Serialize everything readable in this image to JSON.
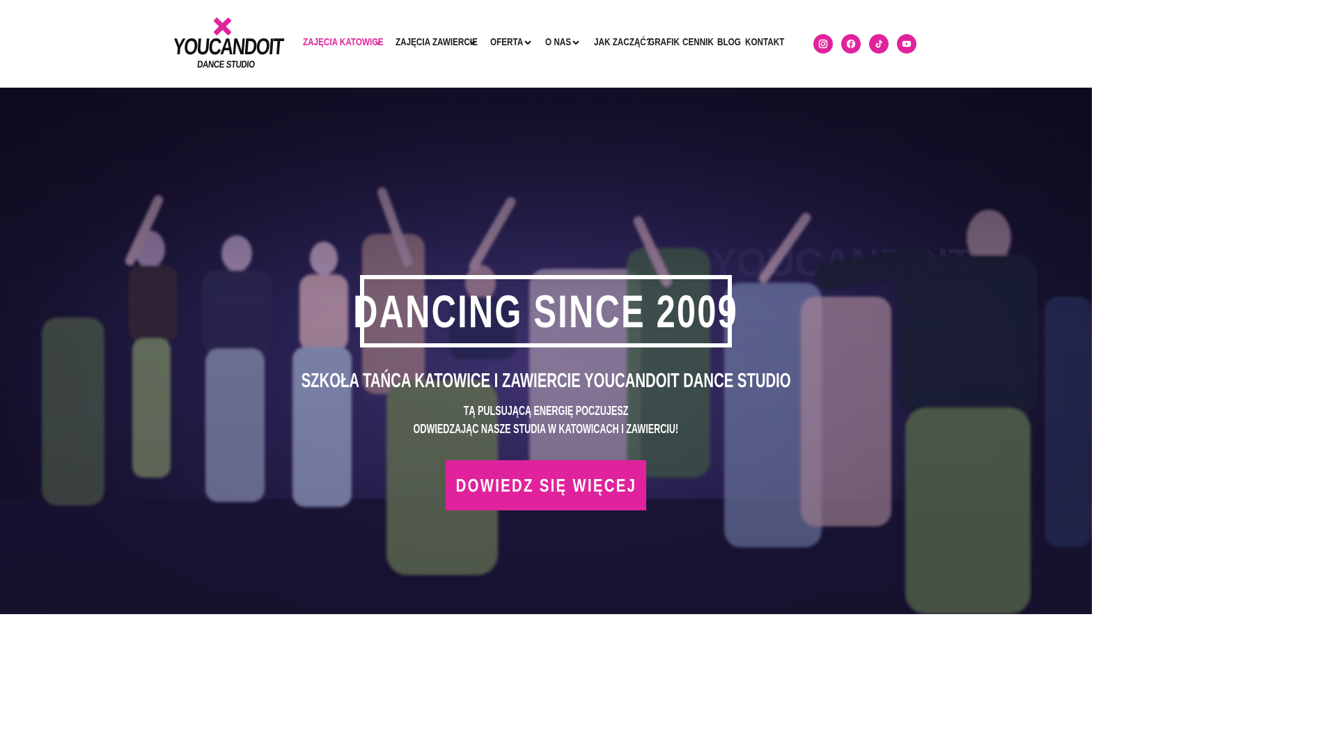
{
  "brand": {
    "logo_word": "YOUCANDOIT",
    "logo_sub": "DANCE STUDIO",
    "accent_color": "#e0239c"
  },
  "nav": {
    "items": [
      {
        "label": "ZAJĘCIA KATOWICE",
        "dropdown": true,
        "active": true
      },
      {
        "label": "ZAJĘCIA ZAWIERCIE",
        "dropdown": true,
        "active": false
      },
      {
        "label": "OFERTA",
        "dropdown": true,
        "active": false
      },
      {
        "label": "O NAS",
        "dropdown": true,
        "active": false
      },
      {
        "label": "JAK ZACZĄĆ?",
        "dropdown": false,
        "active": false
      },
      {
        "label": "GRAFIK",
        "dropdown": false,
        "active": false
      },
      {
        "label": "CENNIK",
        "dropdown": false,
        "active": false
      },
      {
        "label": "BLOG",
        "dropdown": false,
        "active": false
      },
      {
        "label": "KONTAKT",
        "dropdown": false,
        "active": false
      }
    ]
  },
  "socials": [
    {
      "icon": "instagram-icon"
    },
    {
      "icon": "facebook-icon"
    },
    {
      "icon": "tiktok-icon"
    },
    {
      "icon": "youtube-icon"
    }
  ],
  "hero": {
    "headline": "DANCING SINCE 2009",
    "subtitle": "SZKOŁA TAŃCA KATOWICE I ZAWIERCIE YOUCANDOIT DANCE STUDIO",
    "desc_line1": "TĄ PULSUJĄCĄ ENERGIĘ POCZUJESZ",
    "desc_line2": "ODWIEDZAJĄC NASZE STUDIA W KATOWICACH I ZAWIERCIU!",
    "cta_label": "DOWIEDZ SIĘ WIĘCEJ"
  }
}
